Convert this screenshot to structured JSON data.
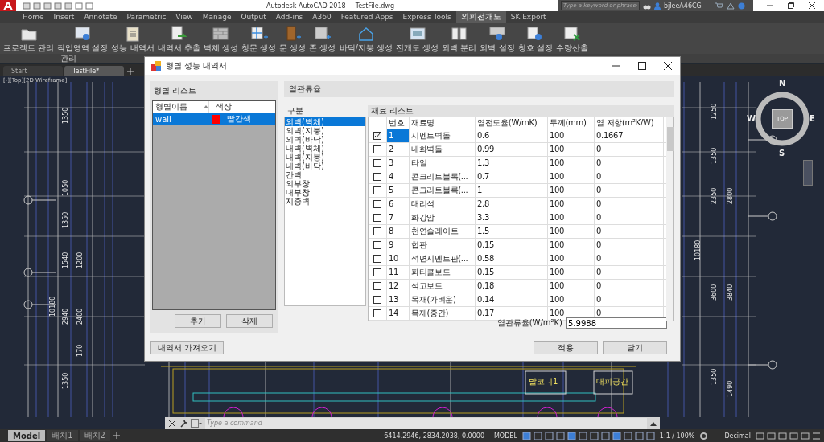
{
  "title_bar": {
    "app_name": "Autodesk AutoCAD 2018",
    "file_name": "TestFile.dwg",
    "search": {
      "placeholder": "Type a keyword or phrase"
    },
    "user": "bjleeA46CG"
  },
  "ribbon_tabs": [
    {
      "label": "Home",
      "selected": false
    },
    {
      "label": "Insert",
      "selected": false
    },
    {
      "label": "Annotate",
      "selected": false
    },
    {
      "label": "Parametric",
      "selected": false
    },
    {
      "label": "View",
      "selected": false
    },
    {
      "label": "Manage",
      "selected": false
    },
    {
      "label": "Output",
      "selected": false
    },
    {
      "label": "Add-ins",
      "selected": false
    },
    {
      "label": "A360",
      "selected": false
    },
    {
      "label": "Featured Apps",
      "selected": false
    },
    {
      "label": "Express Tools",
      "selected": false
    },
    {
      "label": "외피전개도",
      "selected": true
    },
    {
      "label": "SK Export",
      "selected": false
    }
  ],
  "ribbon_buttons": [
    {
      "label": "프로젝트 관리",
      "kind": "folder"
    },
    {
      "label": "작업영역 설정",
      "kind": "monitor"
    },
    {
      "label": "성능 내역서",
      "kind": "clipboard"
    },
    {
      "label": "내역서 추출",
      "kind": "export"
    },
    {
      "label": "벽체 생성",
      "kind": "brick"
    },
    {
      "label": "창문 생성",
      "kind": "window"
    },
    {
      "label": "문 생성",
      "kind": "door"
    },
    {
      "label": "존 생성",
      "kind": "pattern"
    },
    {
      "label": "바닥/지붕 생성",
      "kind": "house"
    },
    {
      "label": "전개도 생성",
      "kind": "panel"
    },
    {
      "label": "외벽 분리",
      "kind": "split"
    },
    {
      "label": "외벽 설정",
      "kind": "wallgear"
    },
    {
      "label": "창호 설정",
      "kind": "windowgear"
    },
    {
      "label": "수량산출",
      "kind": "sheet"
    }
  ],
  "ribbon_panel_title": "관리",
  "file_tabs": [
    {
      "label": "Start",
      "selected": false
    },
    {
      "label": "TestFile*",
      "selected": true
    }
  ],
  "viewport": {
    "label": "[-][Top][2D Wireframe]",
    "viewcube": {
      "north": "N",
      "west": "W",
      "east": "E",
      "south": "S",
      "face": "TOP"
    },
    "left_dimensions": [
      "1350",
      "1050",
      "1350",
      "1540",
      "2940",
      "1350"
    ],
    "left_dimensions_inner": [
      "1200",
      "2400",
      "170"
    ],
    "left_total": "10180",
    "right_dimensions": [
      "1250",
      "1350",
      "2350",
      "3600",
      "1350"
    ],
    "right_dimensions_inner": [
      "2800",
      "3840",
      "1490"
    ],
    "right_total": "10180",
    "room_labels": [
      "발코니1",
      "대피공간"
    ]
  },
  "command_line": {
    "placeholder": "Type a command"
  },
  "layout_tabs": [
    {
      "label": "Model",
      "selected": true
    },
    {
      "label": "배치1",
      "selected": false
    },
    {
      "label": "배치2",
      "selected": false
    }
  ],
  "status_bar": {
    "coordinates": "-6414.2946, 2834.2038, 0.0000",
    "space": "MODEL",
    "scale": "1:1 / 100%",
    "units": "Decimal"
  },
  "dialog": {
    "title": "형별 성능 내역서",
    "type_list": {
      "title": "형별 리스트",
      "columns": [
        "형별이름",
        "색상"
      ],
      "rows": [
        {
          "name": "wall",
          "color": "#ff0000",
          "color_name": "빨간색",
          "selected": true
        }
      ],
      "buttons": [
        "추가",
        "삭제"
      ]
    },
    "import_button": "내역서 가져오기",
    "section_title": "열관류율",
    "category": {
      "title": "구분",
      "items": [
        {
          "label": "외벽(벽체)",
          "selected": true
        },
        {
          "label": "외벽(지붕)",
          "selected": false
        },
        {
          "label": "외벽(바닥)",
          "selected": false
        },
        {
          "label": "내벽(벽체)",
          "selected": false
        },
        {
          "label": "내벽(지붕)",
          "selected": false
        },
        {
          "label": "내벽(바닥)",
          "selected": false
        },
        {
          "label": "간벽",
          "selected": false
        },
        {
          "label": "외부창",
          "selected": false
        },
        {
          "label": "내부창",
          "selected": false
        },
        {
          "label": "지중벽",
          "selected": false
        }
      ]
    },
    "materials": {
      "title": "재료 리스트",
      "columns": [
        "번호",
        "재료명",
        "열전도율(W/mK)",
        "두께(mm)",
        "열 저항(m²K/W)"
      ],
      "rows": [
        {
          "checked": true,
          "selected": true,
          "cells": [
            "1",
            "시멘트벽돌",
            "0.6",
            "100",
            "0.1667"
          ]
        },
        {
          "checked": false,
          "selected": false,
          "cells": [
            "2",
            "내화벽돌",
            "0.99",
            "100",
            "0"
          ]
        },
        {
          "checked": false,
          "selected": false,
          "cells": [
            "3",
            "타일",
            "1.3",
            "100",
            "0"
          ]
        },
        {
          "checked": false,
          "selected": false,
          "cells": [
            "4",
            "콘크리트블록(...",
            "0.7",
            "100",
            "0"
          ]
        },
        {
          "checked": false,
          "selected": false,
          "cells": [
            "5",
            "콘크리트블록(...",
            "1",
            "100",
            "0"
          ]
        },
        {
          "checked": false,
          "selected": false,
          "cells": [
            "6",
            "대리석",
            "2.8",
            "100",
            "0"
          ]
        },
        {
          "checked": false,
          "selected": false,
          "cells": [
            "7",
            "화강암",
            "3.3",
            "100",
            "0"
          ]
        },
        {
          "checked": false,
          "selected": false,
          "cells": [
            "8",
            "천연슬레이트",
            "1.5",
            "100",
            "0"
          ]
        },
        {
          "checked": false,
          "selected": false,
          "cells": [
            "9",
            "합판",
            "0.15",
            "100",
            "0"
          ]
        },
        {
          "checked": false,
          "selected": false,
          "cells": [
            "10",
            "석면시멘트판(...",
            "0.58",
            "100",
            "0"
          ]
        },
        {
          "checked": false,
          "selected": false,
          "cells": [
            "11",
            "파티클보드",
            "0.15",
            "100",
            "0"
          ]
        },
        {
          "checked": false,
          "selected": false,
          "cells": [
            "12",
            "석고보드",
            "0.18",
            "100",
            "0"
          ]
        },
        {
          "checked": false,
          "selected": false,
          "cells": [
            "13",
            "목재(가벼운)",
            "0.14",
            "100",
            "0"
          ]
        },
        {
          "checked": false,
          "selected": false,
          "cells": [
            "14",
            "목재(중간)",
            "0.17",
            "100",
            "0"
          ]
        }
      ]
    },
    "u_value": {
      "label": "열관류율(W/m²K)",
      "value": "5.9988"
    },
    "buttons": [
      "적용",
      "닫기"
    ]
  }
}
